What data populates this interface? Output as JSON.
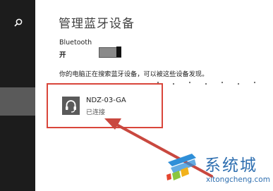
{
  "sidebar": {
    "search_icon": "search-icon"
  },
  "page": {
    "title": "管理蓝牙设备"
  },
  "bluetooth": {
    "label": "Bluetooth",
    "state": "开",
    "toggle_on": true
  },
  "description": "你的电脑正在搜索蓝牙设备，可以被这些设备发现。",
  "device": {
    "name": "NDZ-03-GA",
    "status": "已连接",
    "icon": "headset-icon"
  },
  "watermark": {
    "brand": "系统城",
    "url": "xitongcheng.com"
  },
  "colors": {
    "highlight": "#d9453a",
    "arrow": "#c9483f",
    "sidebar": "#1c1c1c",
    "brand_blue": "#2f6fb0"
  }
}
